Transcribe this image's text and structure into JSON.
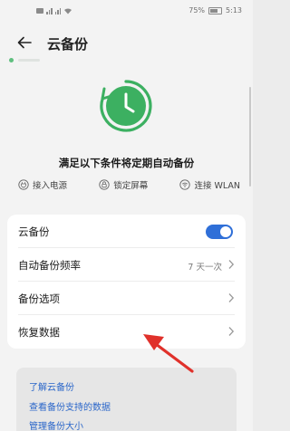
{
  "status_bar": {
    "battery": "75%",
    "time": "5:13"
  },
  "header": {
    "title": "云备份"
  },
  "hero": {
    "condition_title": "满足以下条件将定期自动备份",
    "conditions": [
      {
        "label": "接入电源",
        "icon": "power-plug-icon"
      },
      {
        "label": "锁定屏幕",
        "icon": "lock-icon"
      },
      {
        "label": "连接 WLAN",
        "icon": "wifi-icon"
      }
    ]
  },
  "settings": {
    "cloud_backup_label": "云备份",
    "cloud_backup_enabled": true,
    "auto_frequency_label": "自动备份频率",
    "auto_frequency_value": "7 天一次",
    "backup_options_label": "备份选项",
    "restore_label": "恢复数据"
  },
  "links": {
    "learn": "了解云备份",
    "supported": "查看备份支持的数据",
    "manage": "管理备份大小"
  },
  "colors": {
    "accent_green": "#3cb061",
    "toggle_blue": "#2f6fd8",
    "link_blue": "#2a66c9",
    "arrow_red": "#e0312b"
  }
}
